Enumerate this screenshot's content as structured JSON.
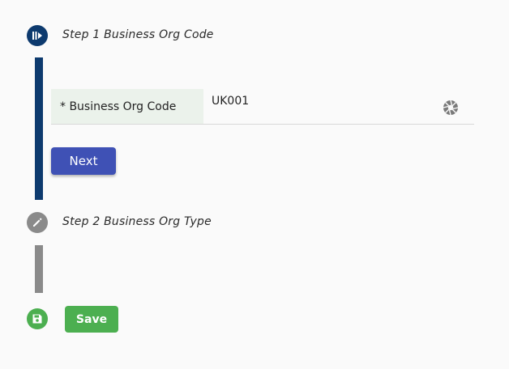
{
  "steps": [
    {
      "title": "Step 1 Business Org Code",
      "icon": "step-active-icon",
      "color": "#0d3a6e"
    },
    {
      "title": "Step 2 Business Org Type",
      "icon": "pencil-icon",
      "color": "#8a8a8a"
    }
  ],
  "form": {
    "field_label": "* Business Org Code",
    "field_value": "UK001",
    "field_icon": "aperture-icon"
  },
  "buttons": {
    "next_label": "Next",
    "save_label": "Save"
  },
  "colors": {
    "primary": "#3f51b5",
    "success": "#4caf50",
    "step_active": "#0d3a6e",
    "step_inactive": "#8a8a8a",
    "label_bg": "#ebf2eb"
  }
}
